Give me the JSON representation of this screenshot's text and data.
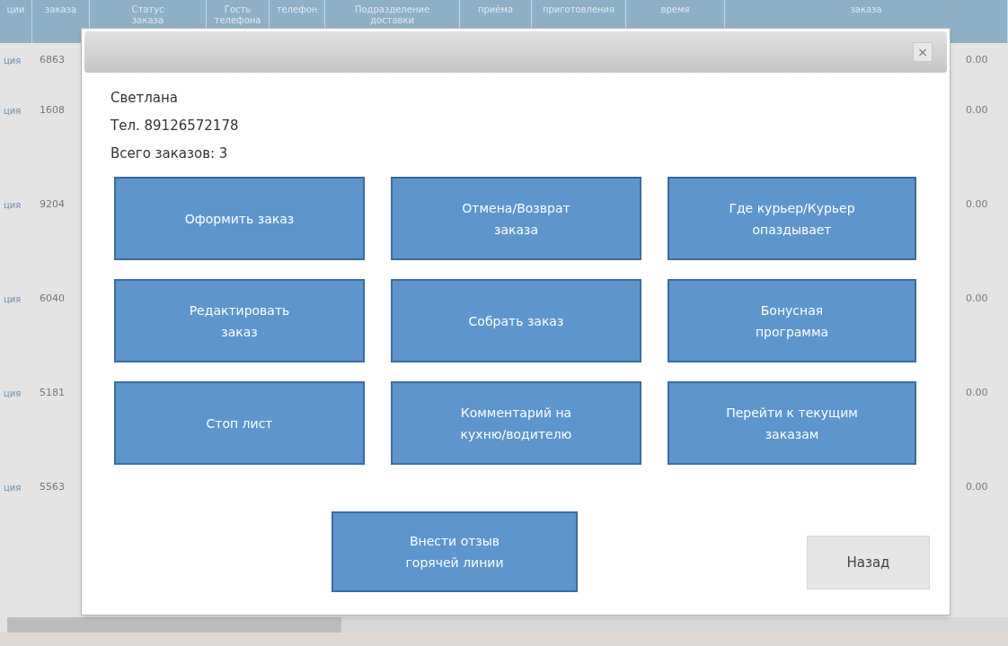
{
  "table": {
    "columns": [
      {
        "lines": [
          "ции"
        ]
      },
      {
        "lines": [
          "заказа"
        ]
      },
      {
        "lines": [
          "Статус",
          "заказа"
        ]
      },
      {
        "lines": [
          "Гость",
          "телефона"
        ]
      },
      {
        "lines": [
          "телефон"
        ]
      },
      {
        "lines": [
          "Подразделение",
          "доставки"
        ]
      },
      {
        "lines": [
          "приёма"
        ]
      },
      {
        "lines": [
          "приготовления"
        ]
      },
      {
        "lines": [
          "время"
        ]
      },
      {
        "lines": [
          "заказа"
        ]
      }
    ],
    "rows": [
      {
        "column_1": "ция",
        "column_2": "6863",
        "column_3": "0.00"
      },
      {
        "column_1": "ция",
        "column_2": "1608",
        "column_3": "0.00"
      },
      {
        "column_1": "ция",
        "column_2": "9204",
        "column_3": "0.00"
      },
      {
        "column_1": "ция",
        "column_2": "6040",
        "column_3": "0.00"
      },
      {
        "column_1": "ция",
        "column_2": "5181",
        "column_3": "0.00"
      },
      {
        "column_1": "ция",
        "column_2": "5563",
        "column_3": "0.00"
      }
    ]
  },
  "dialog": {
    "close": "×",
    "customer_name": "Светлана",
    "phone": "Тел. 89126572178",
    "total_orders": "Всего заказов: 3",
    "actions": [
      "Оформить заказ",
      "Отмена/Возврат заказа",
      "Где курьер/Курьер опаздывает",
      "Редактировать заказ",
      "Собрать заказ",
      "Бонусная программа",
      "Стоп лист",
      "Комментарий на кухню/водителю",
      "Перейти к текущим заказам"
    ],
    "feedback_button": "Внести отзыв горячей линии",
    "back_button": "Назад"
  }
}
